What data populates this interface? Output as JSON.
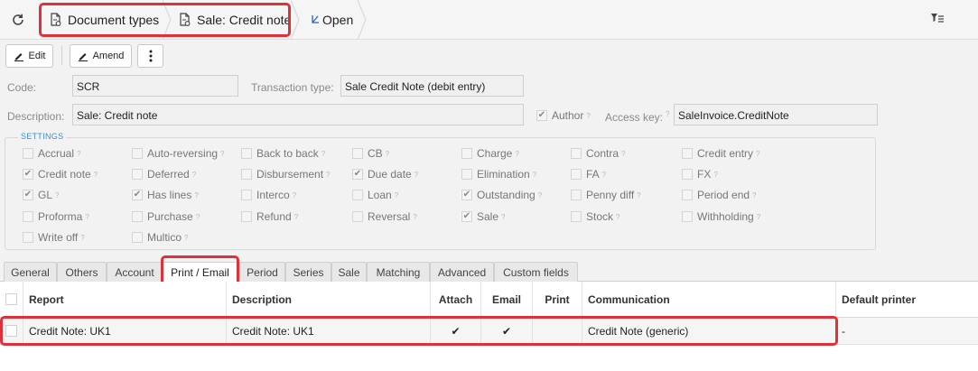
{
  "nav": {
    "breadcrumbs": [
      "Document types",
      "Sale: Credit note"
    ],
    "open_label": "Open"
  },
  "toolbar": {
    "edit_label": "Edit",
    "amend_label": "Amend"
  },
  "form": {
    "code_label": "Code:",
    "code_value": "SCR",
    "transaction_type_label": "Transaction type:",
    "transaction_type_value": "Sale Credit Note (debit entry)",
    "description_label": "Description:",
    "description_value": "Sale: Credit note",
    "author_label": "Author",
    "author_checked": true,
    "access_key_label": "Access key:",
    "access_key_value": "SaleInvoice.CreditNote"
  },
  "settings": {
    "title": "SETTINGS",
    "items": [
      {
        "label": "Accrual",
        "checked": false
      },
      {
        "label": "Auto-reversing",
        "checked": false
      },
      {
        "label": "Back to back",
        "checked": false
      },
      {
        "label": "CB",
        "checked": false
      },
      {
        "label": "Charge",
        "checked": false
      },
      {
        "label": "Contra",
        "checked": false
      },
      {
        "label": "Credit entry",
        "checked": false
      },
      {
        "label": "Credit note",
        "checked": true
      },
      {
        "label": "Deferred",
        "checked": false
      },
      {
        "label": "Disbursement",
        "checked": false
      },
      {
        "label": "Due date",
        "checked": true
      },
      {
        "label": "Elimination",
        "checked": false
      },
      {
        "label": "FA",
        "checked": false
      },
      {
        "label": "FX",
        "checked": false
      },
      {
        "label": "GL",
        "checked": true
      },
      {
        "label": "Has lines",
        "checked": true
      },
      {
        "label": "Interco",
        "checked": false
      },
      {
        "label": "Loan",
        "checked": false
      },
      {
        "label": "Outstanding",
        "checked": true
      },
      {
        "label": "Penny diff",
        "checked": false
      },
      {
        "label": "Period end",
        "checked": false
      },
      {
        "label": "Proforma",
        "checked": false
      },
      {
        "label": "Purchase",
        "checked": false
      },
      {
        "label": "Refund",
        "checked": false
      },
      {
        "label": "Reversal",
        "checked": false
      },
      {
        "label": "Sale",
        "checked": true
      },
      {
        "label": "Stock",
        "checked": false
      },
      {
        "label": "Withholding",
        "checked": false
      },
      {
        "label": "Write off",
        "checked": false
      },
      {
        "label": "Multico",
        "checked": false
      }
    ]
  },
  "tabs": [
    {
      "label": "General"
    },
    {
      "label": "Others"
    },
    {
      "label": "Account"
    },
    {
      "label": "Print / Email",
      "active": true
    },
    {
      "label": "Period"
    },
    {
      "label": "Series"
    },
    {
      "label": "Sale"
    },
    {
      "label": "Matching"
    },
    {
      "label": "Advanced"
    },
    {
      "label": "Custom fields"
    }
  ],
  "table": {
    "columns": [
      "Report",
      "Description",
      "Attach",
      "Email",
      "Print",
      "Communication",
      "Default printer"
    ],
    "rows": [
      {
        "report": "Credit Note: UK1",
        "description": "Credit Note: UK1",
        "attach": "✔",
        "email": "✔",
        "print": "",
        "communication": "Credit Note (generic)",
        "default_printer": "-"
      }
    ]
  }
}
